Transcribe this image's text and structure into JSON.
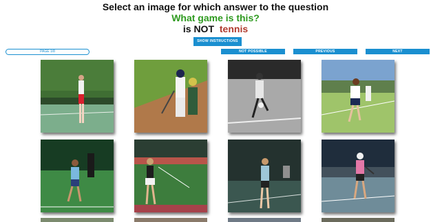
{
  "header": {
    "instruction": "Select an image for which answer to the question",
    "question": "What game is this?",
    "negation_prefix": "is NOT",
    "answer": "tennis"
  },
  "buttons": {
    "show_instructions": "SHOW INSTRUCTIONS",
    "not_possible": "NOT POSSIBLE",
    "previous": "PREVIOUS",
    "next": "NEXT"
  },
  "pager": {
    "label": "PAGE 1/8"
  },
  "images": [
    {
      "subject": "man in red shorts on tennis court"
    },
    {
      "subject": "baseball batter and catcher"
    },
    {
      "subject": "black and white soccer player kicking ball"
    },
    {
      "subject": "men playing tennis on grass"
    },
    {
      "subject": "tennis player on green court with sponsor banner"
    },
    {
      "subject": "woman tennis player with racket"
    },
    {
      "subject": "woman tennis player on dark court"
    },
    {
      "subject": "woman tennis player in pink"
    }
  ],
  "colors": {
    "question": "#2e9a1f",
    "answer": "#b03a2e",
    "button": "#1a8fd0"
  }
}
